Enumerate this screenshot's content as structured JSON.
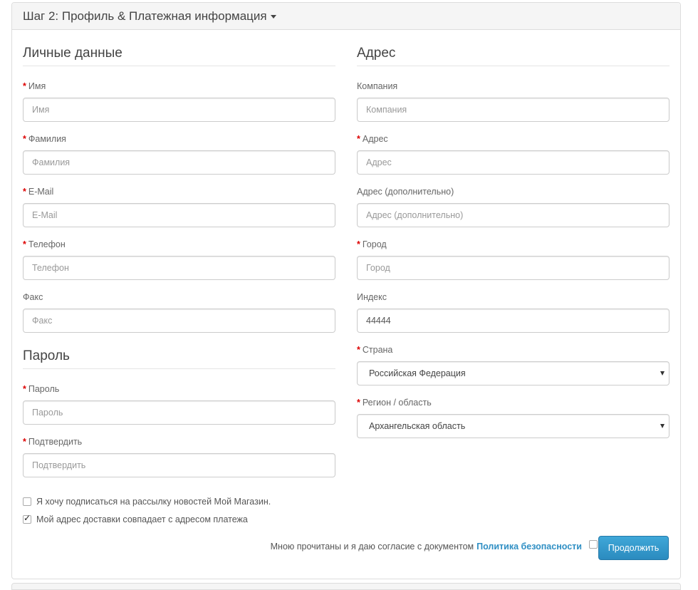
{
  "panel": {
    "title": "Шаг 2: Профиль & Платежная информация"
  },
  "personal": {
    "legend": "Личные данные",
    "fields": [
      {
        "label": "Имя",
        "placeholder": "Имя",
        "required": true
      },
      {
        "label": "Фамилия",
        "placeholder": "Фамилия",
        "required": true
      },
      {
        "label": "E-Mail",
        "placeholder": "E-Mail",
        "required": true
      },
      {
        "label": "Телефон",
        "placeholder": "Телефон",
        "required": true
      },
      {
        "label": "Факс",
        "placeholder": "Факс",
        "required": false
      }
    ]
  },
  "password": {
    "legend": "Пароль",
    "fields": [
      {
        "label": "Пароль",
        "placeholder": "Пароль",
        "required": true
      },
      {
        "label": "Подтвердить",
        "placeholder": "Подтвердить",
        "required": true
      }
    ]
  },
  "address": {
    "legend": "Адрес",
    "fields": [
      {
        "label": "Компания",
        "placeholder": "Компания",
        "required": false
      },
      {
        "label": "Адрес",
        "placeholder": "Адрес",
        "required": true
      },
      {
        "label": "Адрес (дополнительно)",
        "placeholder": "Адрес (дополнительно)",
        "required": false
      },
      {
        "label": "Город",
        "placeholder": "Город",
        "required": true
      },
      {
        "label": "Индекс",
        "value": "44444",
        "required": false
      }
    ],
    "country": {
      "label": "Страна",
      "value": "Российская Федерация",
      "required": true
    },
    "region": {
      "label": "Регион / область",
      "value": "Архангельская область",
      "required": true
    }
  },
  "newsletter": {
    "label": "Я хочу подписаться на рассылку новостей Мой Магазин.",
    "checked": false
  },
  "same_address": {
    "label": "Мой адрес доставки совпадает с адресом платежа",
    "checked": true
  },
  "agree": {
    "text": "Мною прочитаны и я даю согласие с документом",
    "link": "Политика безопасности",
    "checked": false
  },
  "continue_button": "Продолжить",
  "required_mark": "*",
  "colors": {
    "accent": "#2f8fc4",
    "required": "#dd0000",
    "button": "#3a9fd3"
  }
}
